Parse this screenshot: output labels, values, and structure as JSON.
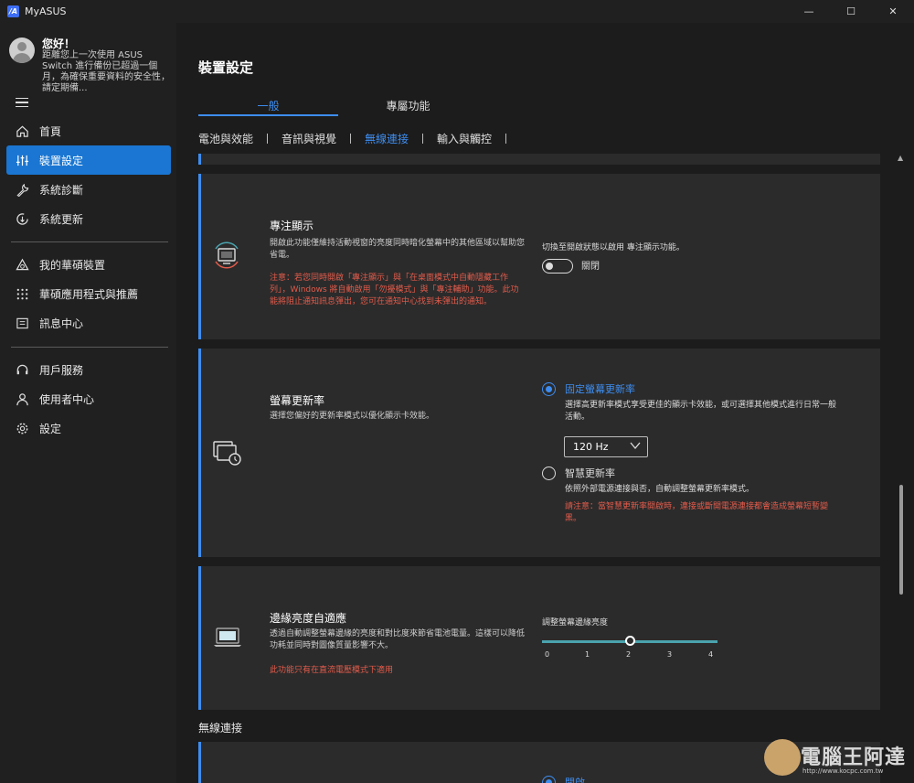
{
  "app": {
    "title": "MyASUS",
    "logo_text": "/A"
  },
  "window_controls": {
    "minimize": "—",
    "maximize": "☐",
    "close": "✕"
  },
  "profile": {
    "greeting": "您好！",
    "message": "距離您上一次使用 ASUS Switch 進行備份已超過一個月，為確保重要資料的安全性，請定期備..."
  },
  "sidebar": {
    "items": [
      {
        "label": "首頁",
        "icon": "home-icon"
      },
      {
        "label": "裝置設定",
        "icon": "sliders-icon",
        "active": true
      },
      {
        "label": "系統診斷",
        "icon": "wrench-icon"
      },
      {
        "label": "系統更新",
        "icon": "update-icon"
      },
      {
        "label": "我的華碩裝置",
        "icon": "asus-triangle-icon"
      },
      {
        "label": "華碩應用程式與推薦",
        "icon": "grid-icon"
      },
      {
        "label": "訊息中心",
        "icon": "message-icon"
      },
      {
        "label": "用戶服務",
        "icon": "headset-icon"
      },
      {
        "label": "使用者中心",
        "icon": "user-icon"
      },
      {
        "label": "設定",
        "icon": "gear-icon"
      }
    ]
  },
  "main": {
    "title": "裝置設定",
    "tabs": [
      {
        "label": "一般",
        "active": true
      },
      {
        "label": "專屬功能",
        "active": false
      }
    ],
    "subtabs": [
      {
        "label": "電池與效能"
      },
      {
        "label": "音訊與視覺"
      },
      {
        "label": "無線連接",
        "active": true
      },
      {
        "label": "輸入與觸控"
      }
    ]
  },
  "cards": {
    "focus": {
      "title": "專注顯示",
      "desc": "開啟此功能僅維持活動視窗的亮度同時暗化螢幕中的其他區域以幫助您省電。",
      "warn": "注意：若您同時開啟「專注顯示」與「在桌面模式中自動隱藏工作列」，Windows 將自動啟用「勿擾模式」與「專注輔助」功能。此功能將阻止通知訊息彈出，您可在通知中心找到未彈出的通知。",
      "right_label": "切換至開啟狀態以啟用 專注顯示功能。",
      "toggle_state": "關閉"
    },
    "refresh": {
      "title": "螢幕更新率",
      "desc": "選擇您偏好的更新率模式以優化顯示卡效能。",
      "option1": "固定螢幕更新率",
      "option1_desc": "選擇高更新率模式享受更佳的顯示卡效能，或可選擇其他模式進行日常一般活動。",
      "rate_value": "120 Hz",
      "option2": "智慧更新率",
      "option2_desc": "依照外部電源連接與否，自動調整螢幕更新率模式。",
      "option2_warn": "請注意：當智慧更新率開啟時，連接或斷開電源連接都會造成螢幕短暫變黑。"
    },
    "edge": {
      "title": "邊緣亮度自適應",
      "desc": "透過自動調整螢幕邊緣的亮度和對比度來節省電池電量。這樣可以降低功耗並同時對圖像質量影響不大。",
      "warn": "此功能只有在直流電壓模式下適用",
      "slider_label": "調整螢幕邊緣亮度",
      "slider_value": 2,
      "slider_ticks": [
        "0",
        "1",
        "2",
        "3",
        "4"
      ]
    }
  },
  "section": {
    "wireless_title": "無線連接",
    "partial_label": "開啟"
  },
  "watermark": {
    "text": "電腦王阿達",
    "url": "http://www.kocpc.com.tw"
  }
}
